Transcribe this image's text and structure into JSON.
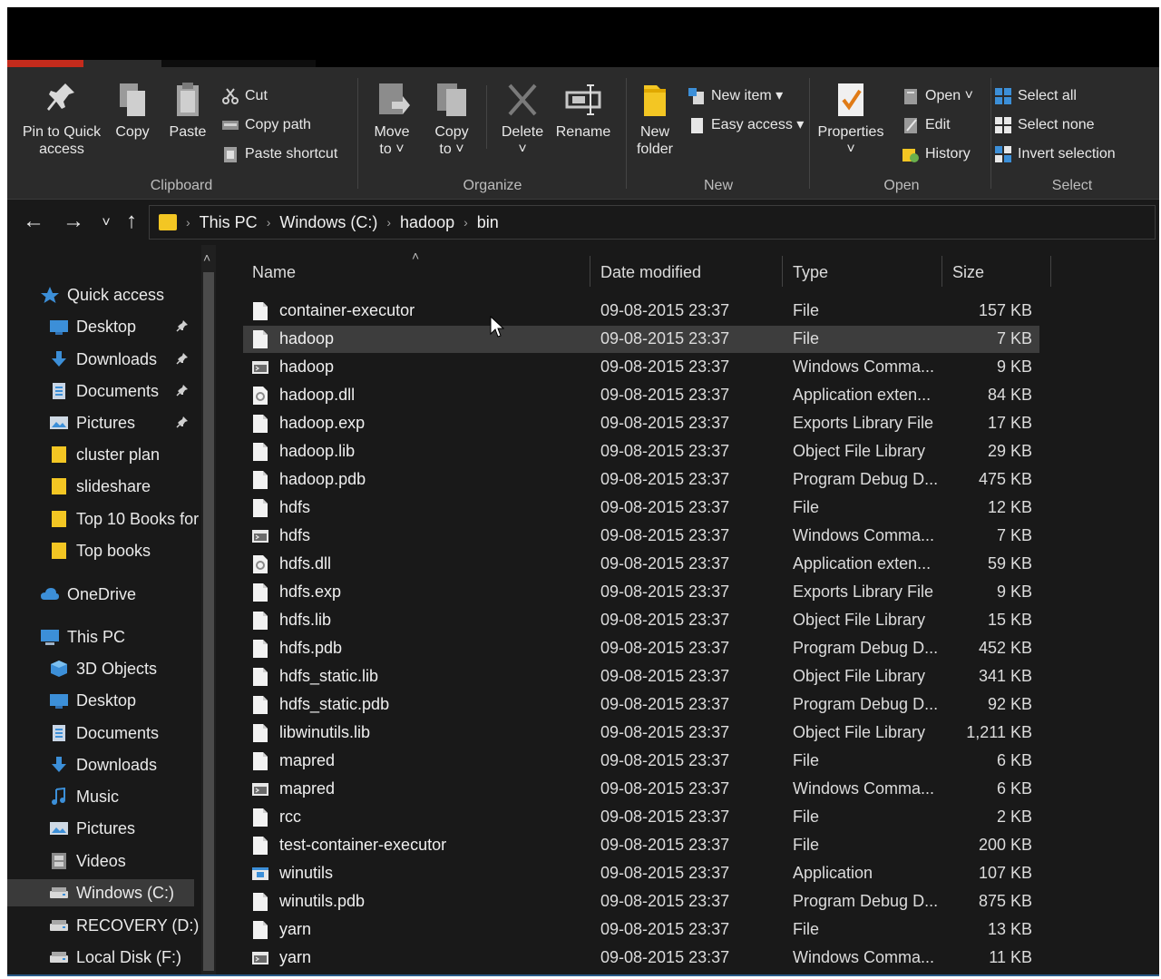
{
  "ribbon": {
    "clipboard": {
      "label": "Clipboard",
      "pin_line1": "Pin to Quick",
      "pin_line2": "access",
      "copy": "Copy",
      "paste": "Paste",
      "cut": "Cut",
      "copy_path": "Copy path",
      "paste_shortcut": "Paste shortcut"
    },
    "organize": {
      "label": "Organize",
      "move_line1": "Move",
      "move_line2": "to ˅",
      "copy_line1": "Copy",
      "copy_line2": "to ˅",
      "delete": "Delete",
      "delete_caret": "˅",
      "rename": "Rename"
    },
    "new": {
      "label": "New",
      "folder_line1": "New",
      "folder_line2": "folder",
      "new_item": "New item ▾",
      "easy_access": "Easy access ▾"
    },
    "open": {
      "label": "Open",
      "properties": "Properties",
      "properties_caret": "˅",
      "open": "Open ˅",
      "edit": "Edit",
      "history": "History"
    },
    "select": {
      "label": "Select",
      "select_all": "Select all",
      "select_none": "Select none",
      "invert": "Invert selection"
    },
    "colors": {
      "accent_tab": "#c42b1c"
    }
  },
  "nav": {
    "back": "←",
    "forward": "→",
    "recent": "˅",
    "up": "↑",
    "breadcrumb": [
      "This PC",
      "Windows (C:)",
      "hadoop",
      "bin"
    ],
    "sep": "›"
  },
  "sidebar": {
    "scroll_up": "˄",
    "items": [
      {
        "label": "Quick access",
        "icon": "star-icon",
        "pinned": false,
        "indent": 0
      },
      {
        "label": "Desktop",
        "icon": "desktop-icon",
        "pinned": true,
        "indent": 1
      },
      {
        "label": "Downloads",
        "icon": "download-icon",
        "pinned": true,
        "indent": 1
      },
      {
        "label": "Documents",
        "icon": "document-icon",
        "pinned": true,
        "indent": 1
      },
      {
        "label": "Pictures",
        "icon": "pictures-icon",
        "pinned": true,
        "indent": 1
      },
      {
        "label": "cluster plan",
        "icon": "folder-icon",
        "pinned": false,
        "indent": 1
      },
      {
        "label": "slideshare",
        "icon": "folder-icon",
        "pinned": false,
        "indent": 1
      },
      {
        "label": "Top 10 Books for",
        "icon": "folder-icon",
        "pinned": false,
        "indent": 1
      },
      {
        "label": "Top books",
        "icon": "folder-icon",
        "pinned": false,
        "indent": 1
      },
      {
        "label": "OneDrive",
        "icon": "cloud-icon",
        "pinned": false,
        "indent": 0
      },
      {
        "label": "This PC",
        "icon": "computer-icon",
        "pinned": false,
        "indent": 0
      },
      {
        "label": "3D Objects",
        "icon": "cube-icon",
        "pinned": false,
        "indent": 1
      },
      {
        "label": "Desktop",
        "icon": "desktop-icon",
        "pinned": false,
        "indent": 1
      },
      {
        "label": "Documents",
        "icon": "document-icon",
        "pinned": false,
        "indent": 1
      },
      {
        "label": "Downloads",
        "icon": "download-icon",
        "pinned": false,
        "indent": 1
      },
      {
        "label": "Music",
        "icon": "music-icon",
        "pinned": false,
        "indent": 1
      },
      {
        "label": "Pictures",
        "icon": "pictures-icon",
        "pinned": false,
        "indent": 1
      },
      {
        "label": "Videos",
        "icon": "video-icon",
        "pinned": false,
        "indent": 1
      },
      {
        "label": "Windows (C:)",
        "icon": "drive-icon",
        "pinned": false,
        "indent": 1,
        "selected": true
      },
      {
        "label": "RECOVERY (D:)",
        "icon": "drive-icon",
        "pinned": false,
        "indent": 1
      },
      {
        "label": "Local Disk (F:)",
        "icon": "drive-icon",
        "pinned": false,
        "indent": 1
      }
    ],
    "pin_glyph": "📌"
  },
  "list": {
    "columns": {
      "name": "Name",
      "date": "Date modified",
      "type": "Type",
      "size": "Size",
      "sort_caret": "˄"
    },
    "files": [
      {
        "name": "container-executor",
        "date": "09-08-2015 23:37",
        "type": "File",
        "size": "157 KB",
        "icon": "file-icon"
      },
      {
        "name": "hadoop",
        "date": "09-08-2015 23:37",
        "type": "File",
        "size": "7 KB",
        "icon": "file-icon",
        "selected": true
      },
      {
        "name": "hadoop",
        "date": "09-08-2015 23:37",
        "type": "Windows Comma...",
        "size": "9 KB",
        "icon": "cmd-icon"
      },
      {
        "name": "hadoop.dll",
        "date": "09-08-2015 23:37",
        "type": "Application exten...",
        "size": "84 KB",
        "icon": "dll-icon"
      },
      {
        "name": "hadoop.exp",
        "date": "09-08-2015 23:37",
        "type": "Exports Library File",
        "size": "17 KB",
        "icon": "file-icon"
      },
      {
        "name": "hadoop.lib",
        "date": "09-08-2015 23:37",
        "type": "Object File Library",
        "size": "29 KB",
        "icon": "file-icon"
      },
      {
        "name": "hadoop.pdb",
        "date": "09-08-2015 23:37",
        "type": "Program Debug D...",
        "size": "475 KB",
        "icon": "file-icon"
      },
      {
        "name": "hdfs",
        "date": "09-08-2015 23:37",
        "type": "File",
        "size": "12 KB",
        "icon": "file-icon"
      },
      {
        "name": "hdfs",
        "date": "09-08-2015 23:37",
        "type": "Windows Comma...",
        "size": "7 KB",
        "icon": "cmd-icon"
      },
      {
        "name": "hdfs.dll",
        "date": "09-08-2015 23:37",
        "type": "Application exten...",
        "size": "59 KB",
        "icon": "dll-icon"
      },
      {
        "name": "hdfs.exp",
        "date": "09-08-2015 23:37",
        "type": "Exports Library File",
        "size": "9 KB",
        "icon": "file-icon"
      },
      {
        "name": "hdfs.lib",
        "date": "09-08-2015 23:37",
        "type": "Object File Library",
        "size": "15 KB",
        "icon": "file-icon"
      },
      {
        "name": "hdfs.pdb",
        "date": "09-08-2015 23:37",
        "type": "Program Debug D...",
        "size": "452 KB",
        "icon": "file-icon"
      },
      {
        "name": "hdfs_static.lib",
        "date": "09-08-2015 23:37",
        "type": "Object File Library",
        "size": "341 KB",
        "icon": "file-icon"
      },
      {
        "name": "hdfs_static.pdb",
        "date": "09-08-2015 23:37",
        "type": "Program Debug D...",
        "size": "92 KB",
        "icon": "file-icon"
      },
      {
        "name": "libwinutils.lib",
        "date": "09-08-2015 23:37",
        "type": "Object File Library",
        "size": "1,211 KB",
        "icon": "file-icon"
      },
      {
        "name": "mapred",
        "date": "09-08-2015 23:37",
        "type": "File",
        "size": "6 KB",
        "icon": "file-icon"
      },
      {
        "name": "mapred",
        "date": "09-08-2015 23:37",
        "type": "Windows Comma...",
        "size": "6 KB",
        "icon": "cmd-icon"
      },
      {
        "name": "rcc",
        "date": "09-08-2015 23:37",
        "type": "File",
        "size": "2 KB",
        "icon": "file-icon"
      },
      {
        "name": "test-container-executor",
        "date": "09-08-2015 23:37",
        "type": "File",
        "size": "200 KB",
        "icon": "file-icon"
      },
      {
        "name": "winutils",
        "date": "09-08-2015 23:37",
        "type": "Application",
        "size": "107 KB",
        "icon": "app-icon"
      },
      {
        "name": "winutils.pdb",
        "date": "09-08-2015 23:37",
        "type": "Program Debug D...",
        "size": "875 KB",
        "icon": "file-icon"
      },
      {
        "name": "yarn",
        "date": "09-08-2015 23:37",
        "type": "File",
        "size": "13 KB",
        "icon": "file-icon"
      },
      {
        "name": "yarn",
        "date": "09-08-2015 23:37",
        "type": "Windows Comma...",
        "size": "11 KB",
        "icon": "cmd-icon"
      }
    ]
  }
}
